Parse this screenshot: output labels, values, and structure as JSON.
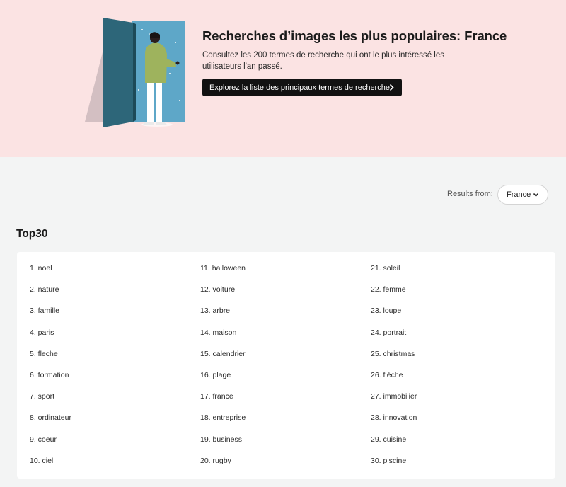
{
  "hero": {
    "title": "Recherches d’images les plus populaires: France",
    "description": "Consultez les 200 termes de recherche qui ont le plus intéressé les utilisateurs l'an passé.",
    "button_label": "Explorez la liste des principaux termes de recherche",
    "background_color": "#fbe3e3"
  },
  "filter": {
    "results_label": "Results from:",
    "country": "France"
  },
  "section": {
    "title": "Top30"
  },
  "terms": [
    "1. noel",
    "2. nature",
    "3. famille",
    "4. paris",
    "5. fleche",
    "6. formation",
    "7. sport",
    "8. ordinateur",
    "9. coeur",
    "10. ciel",
    "11. halloween",
    "12. voiture",
    "13. arbre",
    "14. maison",
    "15. calendrier",
    "16. plage",
    "17. france",
    "18. entreprise",
    "19. business",
    "20. rugby",
    "21. soleil",
    "22. femme",
    "23. loupe",
    "24. portrait",
    "25. christmas",
    "26. flèche",
    "27. immobilier",
    "28. innovation",
    "29. cuisine",
    "30. piscine"
  ]
}
